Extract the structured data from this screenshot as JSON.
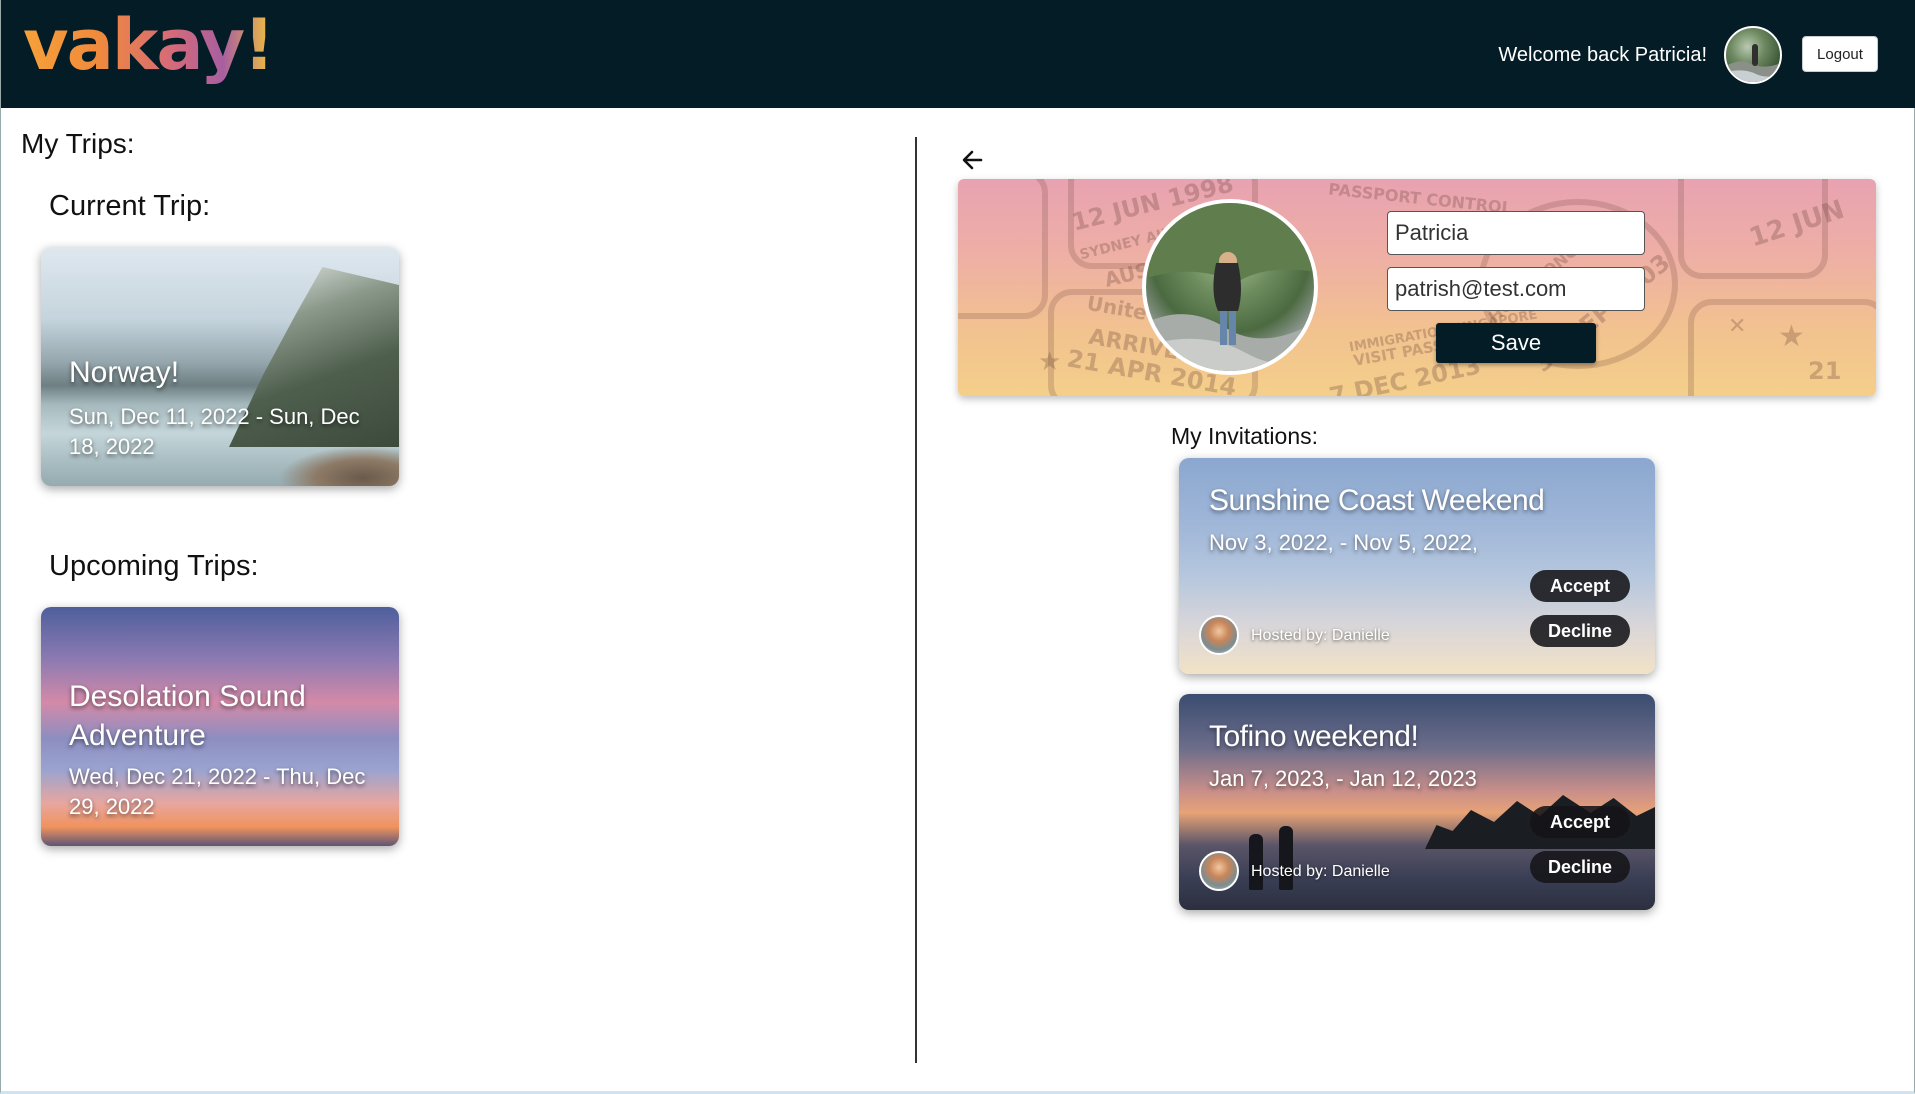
{
  "header": {
    "logo": "vakay!",
    "welcome": "Welcome back Patricia!",
    "logout_label": "Logout",
    "avatar_icon": "user-avatar-icon",
    "background_color": "#041c26"
  },
  "left": {
    "title": "My Trips:",
    "current_heading": "Current Trip:",
    "upcoming_heading": "Upcoming Trips:",
    "current_trips": [
      {
        "title": "Norway!",
        "dates": "Sun, Dec 11, 2022 - Sun, Dec 18, 2022"
      }
    ],
    "upcoming_trips": [
      {
        "title": "Desolation Sound Adventure",
        "dates": "Wed, Dec 21, 2022 - Thu, Dec 29, 2022"
      }
    ]
  },
  "profile": {
    "back_icon": "arrow-left-icon",
    "name_value": "Patricia",
    "email_value": "patrish@test.com",
    "save_label": "Save"
  },
  "invitations": {
    "heading": "My Invitations:",
    "items": [
      {
        "title": "Sunshine Coast Weekend",
        "dates": "Nov 3, 2022, - Nov 5, 2022,",
        "host": "Hosted by: Danielle",
        "accept_label": "Accept",
        "decline_label": "Decline"
      },
      {
        "title": "Tofino weekend!",
        "dates": "Jan 7, 2023, - Jan 12, 2023",
        "host": "Hosted by: Danielle",
        "accept_label": "Accept",
        "decline_label": "Decline"
      }
    ]
  },
  "colors": {
    "navy": "#041c26",
    "button_dark": "#141418"
  }
}
